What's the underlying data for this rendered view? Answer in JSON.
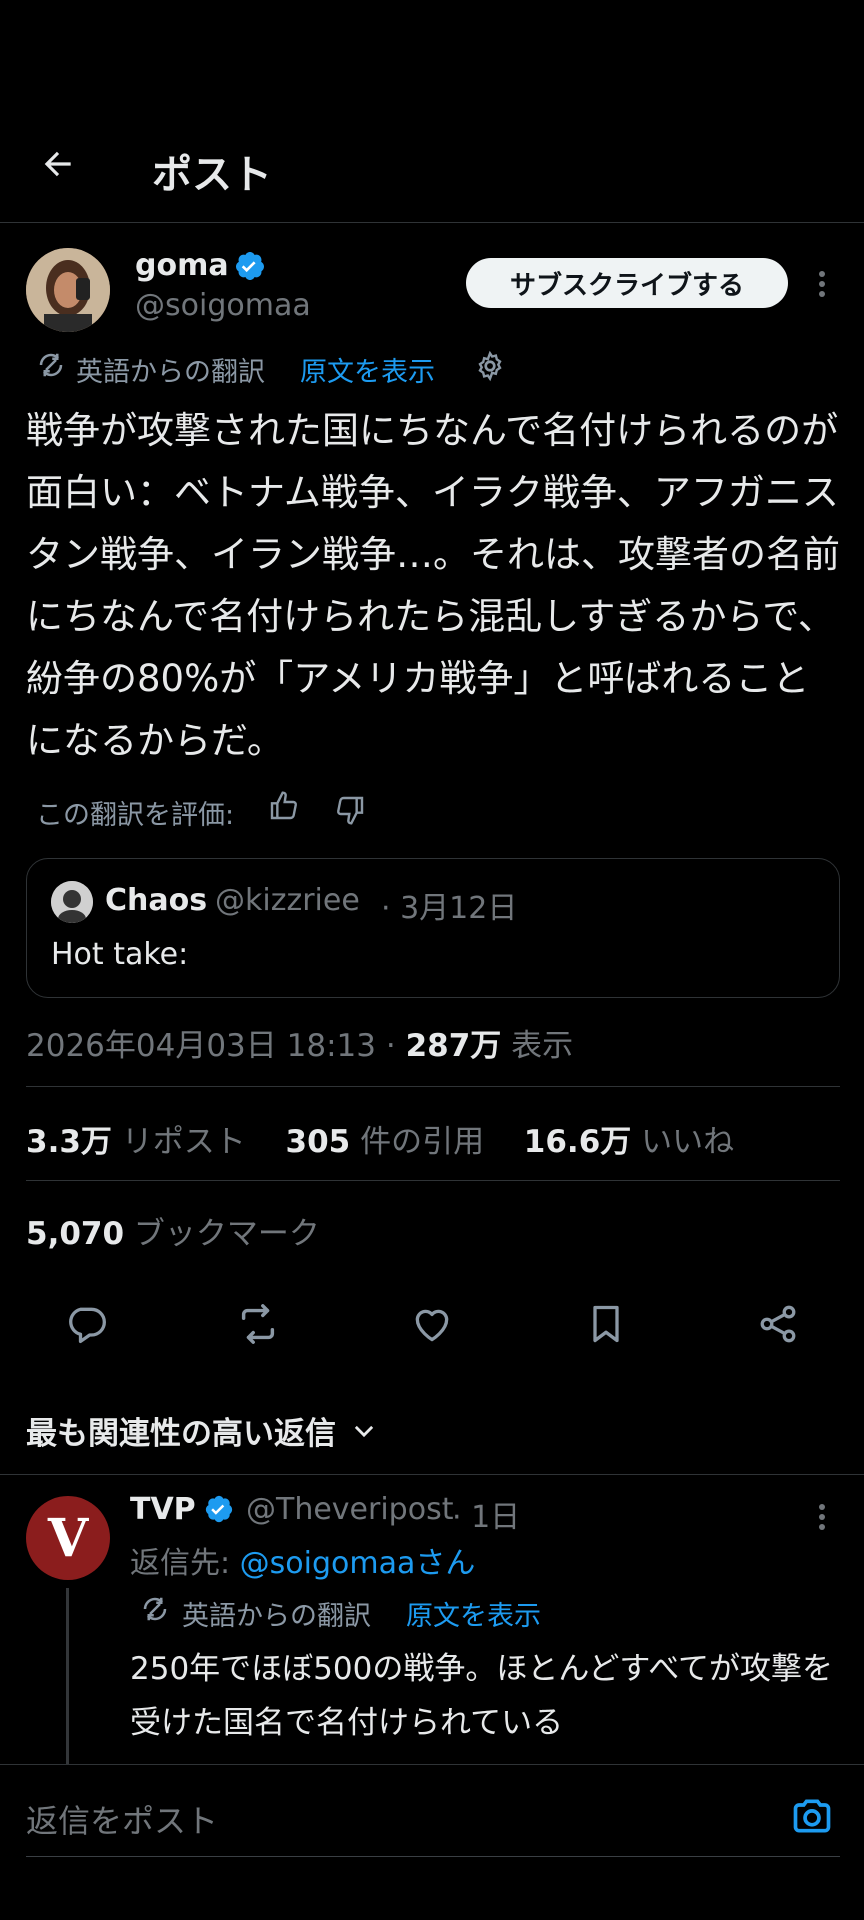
{
  "header": {
    "title": "ポスト"
  },
  "post": {
    "author_name": "goma",
    "author_handle": "@soigomaa",
    "subscribe_label": "サブスクライブする",
    "translation_label": "英語からの翻訳",
    "show_original_label": "原文を表示",
    "body": "戦争が攻撃された国にちなんで名付けられるのが面白い：ベトナム戦争、イラク戦争、アフガニスタン戦争、イラン戦争…。それは、攻撃者の名前にちなんで名付けられたら混乱しすぎるからで、紛争の80%が「アメリカ戦争」と呼ばれることになるからだ。",
    "rate_label": "この翻訳を評価:",
    "timestamp": "2026年04月03日 18:13",
    "dot": "·",
    "views_count": "287万",
    "views_label": "表示"
  },
  "quote": {
    "author_name": "Chaos",
    "author_handle": "@kizzriee",
    "date": "· 3月12日",
    "text": "Hot take:"
  },
  "stats": {
    "reposts_count": "3.3万",
    "reposts_label": "リポスト",
    "quotes_count": "305",
    "quotes_label": "件の引用",
    "likes_count": "16.6万",
    "likes_label": "いいね",
    "bookmarks_count": "5,070",
    "bookmarks_label": "ブックマーク"
  },
  "replies": {
    "sort_label": "最も関連性の高い返信",
    "items": [
      {
        "author_name": "TVP",
        "author_handle": "@Theveripost",
        "time": "· 1日",
        "avatar_letter": "V",
        "reply_to_prefix": "返信先: ",
        "reply_to_handle": "@soigomaaさん",
        "translation_label": "英語からの翻訳",
        "show_original_label": "原文を表示",
        "body": "250年でほぼ500の戦争。ほとんどすべてが攻撃を受けた国名で名付けられている"
      }
    ]
  },
  "composer": {
    "placeholder": "返信をポスト"
  },
  "colors": {
    "accent": "#1d9bf0",
    "background": "#000000",
    "text": "#e7e9ea",
    "muted": "#71767b",
    "divider": "#2f3336",
    "tvp_avatar": "#8b1d1d"
  }
}
